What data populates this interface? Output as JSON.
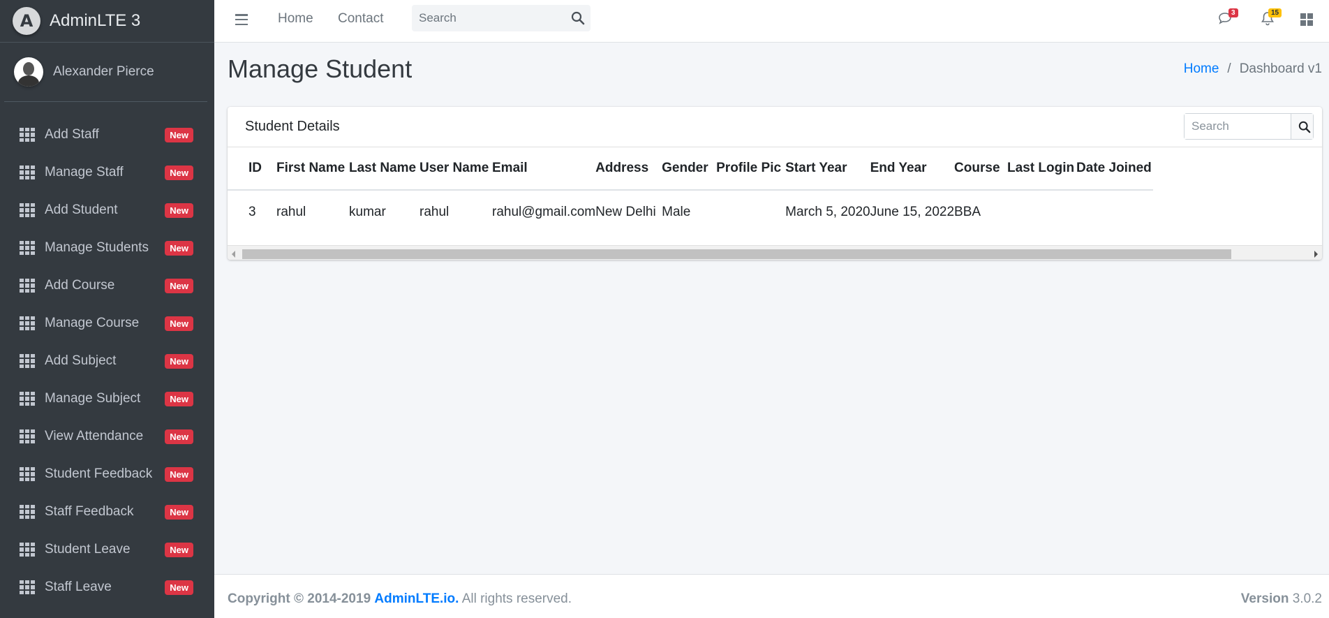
{
  "brand": {
    "title": "AdminLTE 3",
    "logo_letter": "A"
  },
  "user": {
    "name": "Alexander Pierce"
  },
  "sidebar": {
    "badge_label": "New",
    "items": [
      {
        "label": "Add Staff"
      },
      {
        "label": "Manage Staff"
      },
      {
        "label": "Add Student"
      },
      {
        "label": "Manage Students"
      },
      {
        "label": "Add Course"
      },
      {
        "label": "Manage Course"
      },
      {
        "label": "Add Subject"
      },
      {
        "label": "Manage Subject"
      },
      {
        "label": "View Attendance"
      },
      {
        "label": "Student Feedback"
      },
      {
        "label": "Staff Feedback"
      },
      {
        "label": "Student Leave"
      },
      {
        "label": "Staff Leave"
      }
    ]
  },
  "topbar": {
    "home_label": "Home",
    "contact_label": "Contact",
    "search_placeholder": "Search",
    "messages_count": "3",
    "notifications_count": "15",
    "messages_badge_color": "#dc3545",
    "notifications_badge_color": "#ffc107"
  },
  "page": {
    "title": "Manage Student",
    "breadcrumb": {
      "home": "Home",
      "current": "Dashboard v1"
    }
  },
  "card": {
    "title": "Student Details",
    "search_placeholder": "Search",
    "columns": [
      "ID",
      "First Name",
      "Last Name",
      "User Name",
      "Email",
      "Address",
      "Gender",
      "Profile Pic",
      "Start Year",
      "End Year",
      "Course",
      "Last Login",
      "Date Joined"
    ],
    "rows": [
      [
        "3",
        "rahul",
        "kumar",
        "rahul",
        "rahul@gmail.com",
        "New Delhi",
        "Male",
        "",
        "March 5, 2020",
        "June 15, 2022",
        "BBA",
        "",
        ""
      ]
    ]
  },
  "footer": {
    "copyright": "Copyright © 2014-2019",
    "brand_link": "AdminLTE.io.",
    "rights": "All rights reserved.",
    "version_label": "Version",
    "version_value": "3.0.2"
  },
  "colors": {
    "sidebar_bg": "#343a40",
    "accent": "#007bff",
    "badge_new": "#dc3545"
  }
}
